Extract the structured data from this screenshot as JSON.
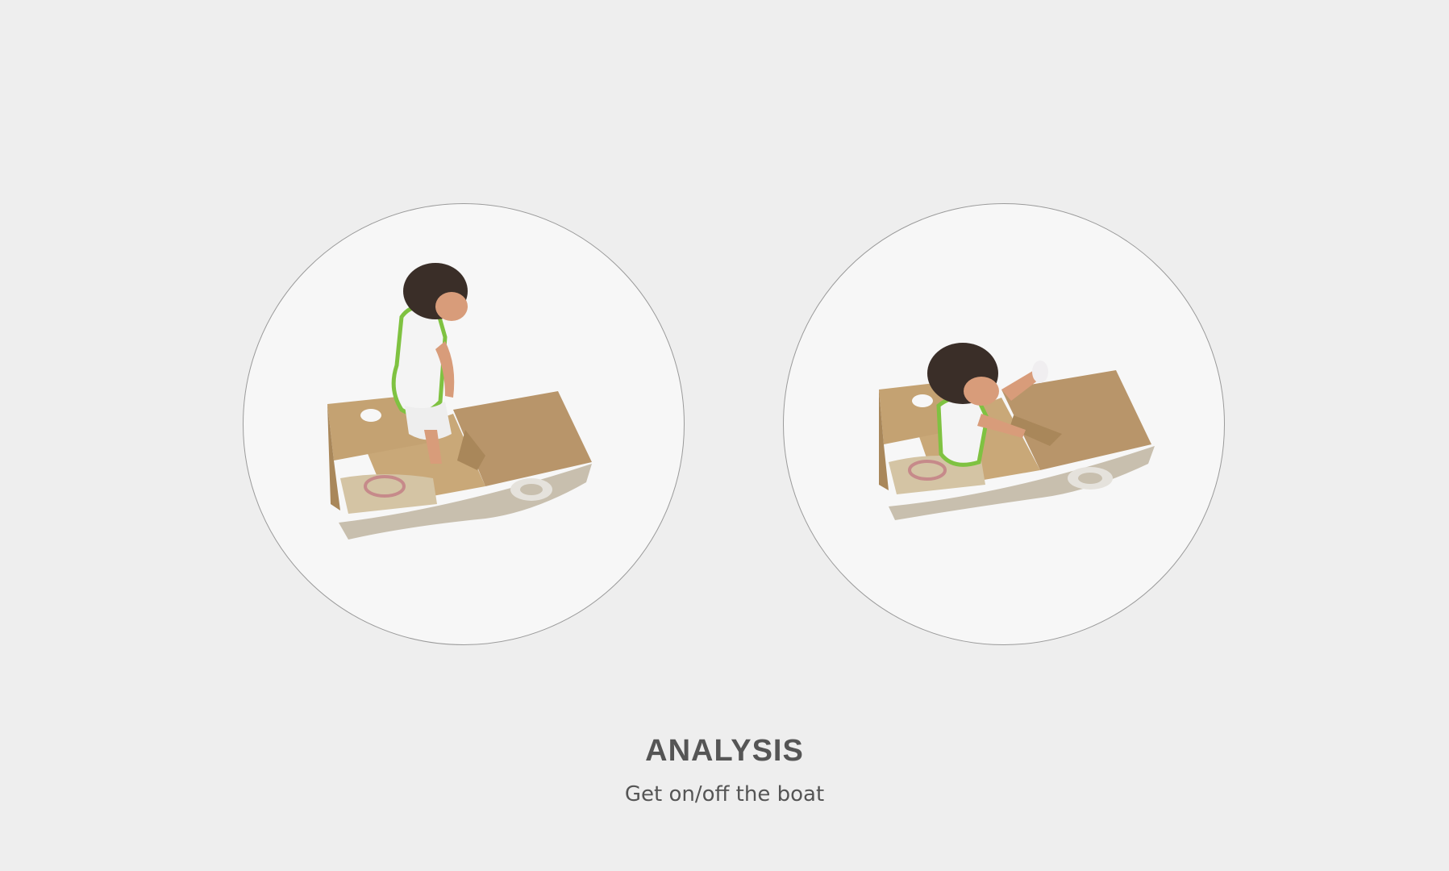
{
  "heading": "ANALYSIS",
  "caption": "Get on/off the boat",
  "colors": {
    "background": "#eeeeee",
    "circle_fill": "#f7f7f7",
    "circle_border": "#9a9a9a",
    "text": "#555555",
    "boat_wood": "#c9a878",
    "boat_wood_dark": "#a9875a",
    "boat_hull": "#c8bfae"
  }
}
